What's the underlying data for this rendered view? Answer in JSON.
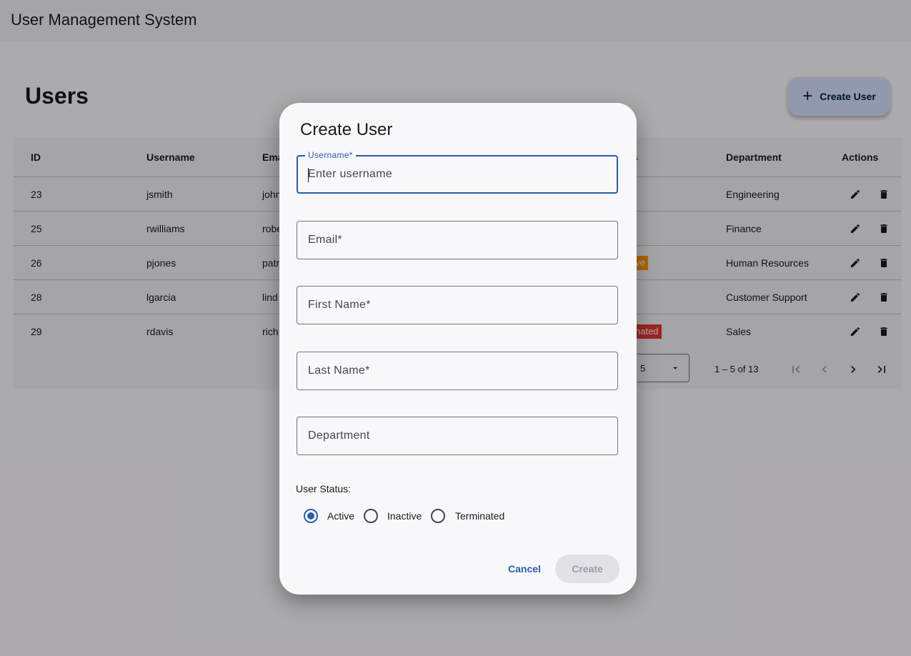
{
  "app": {
    "title": "User Management System"
  },
  "page": {
    "title": "Users",
    "create_button": "Create User"
  },
  "table": {
    "headers": {
      "id": "ID",
      "username": "Username",
      "email": "Ema",
      "status": "s",
      "department": "Department",
      "actions": "Actions"
    },
    "rows": [
      {
        "id": "23",
        "username": "jsmith",
        "email": "john",
        "status": "",
        "status_type": "active",
        "department": "Engineering"
      },
      {
        "id": "25",
        "username": "rwilliams",
        "email": "robe",
        "status": "",
        "status_type": "active",
        "department": "Finance"
      },
      {
        "id": "26",
        "username": "pjones",
        "email": "patr",
        "status": "ve",
        "status_type": "inactive",
        "department": "Human Resources"
      },
      {
        "id": "28",
        "username": "lgarcia",
        "email": "lind",
        "status": "",
        "status_type": "active",
        "department": "Customer Support"
      },
      {
        "id": "29",
        "username": "rdavis",
        "email": "rich",
        "status": "nated",
        "status_type": "terminated",
        "department": "Sales"
      }
    ],
    "pagination": {
      "rows_per_page": "5",
      "range": "1 – 5 of 13"
    }
  },
  "dialog": {
    "title": "Create User",
    "fields": {
      "username": {
        "label": "Username*",
        "placeholder": "Enter username",
        "value": ""
      },
      "email": {
        "label": "Email*",
        "value": ""
      },
      "first_name": {
        "label": "First Name*",
        "value": ""
      },
      "last_name": {
        "label": "Last Name*",
        "value": ""
      },
      "department": {
        "label": "Department",
        "value": ""
      }
    },
    "status_label": "User Status:",
    "status_options": [
      "Active",
      "Inactive",
      "Terminated"
    ],
    "status_selected": "Active",
    "cancel_label": "Cancel",
    "create_label": "Create"
  },
  "colors": {
    "primary": "#2c5da3",
    "status_active": "#4caf50",
    "status_inactive": "#ff9800",
    "status_terminated": "#e53935"
  }
}
